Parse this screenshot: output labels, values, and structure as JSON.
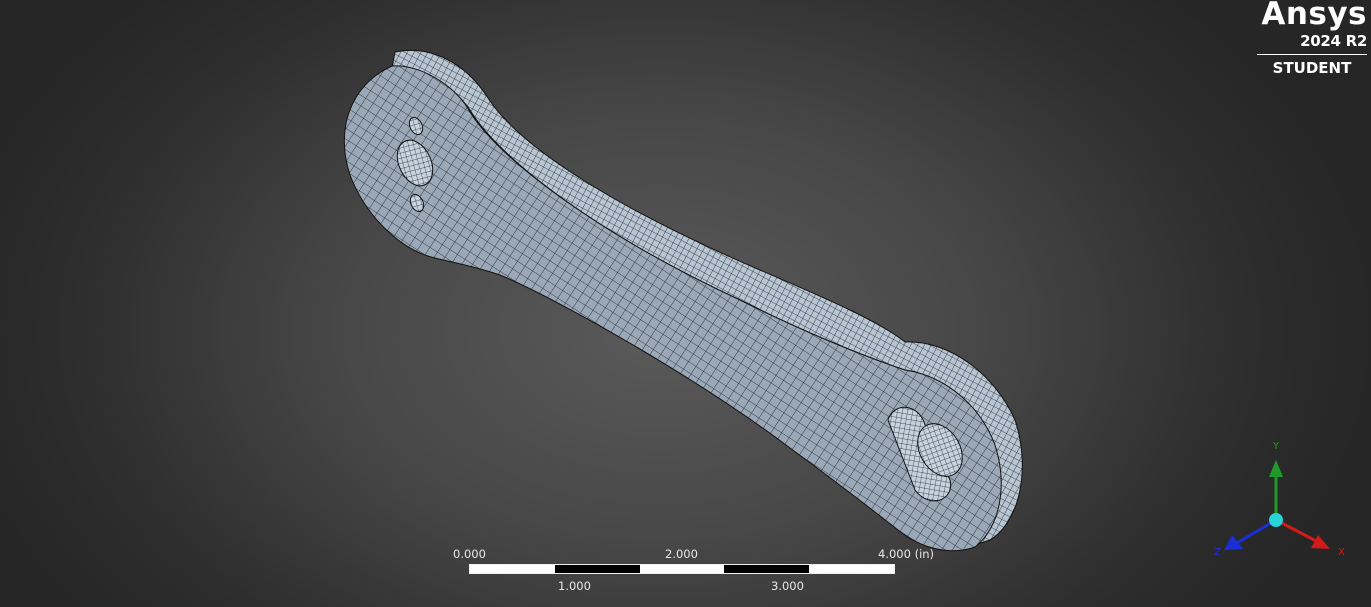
{
  "app": {
    "brand_name": "Ansys",
    "version": "2024 R2",
    "edition": "STUDENT"
  },
  "scale_bar": {
    "labels_top": [
      "0.000",
      "2.000",
      "4.000 (in)"
    ],
    "labels_bottom": [
      "1.000",
      "3.000"
    ]
  },
  "triad": {
    "x_label": "X",
    "y_label": "Y",
    "z_label": "Z",
    "colors": {
      "x": "#d11a1a",
      "y": "#1f9a2a",
      "z": "#1a2fd6",
      "origin": "#28d4d8"
    }
  },
  "model": {
    "description_icon": "meshed-connecting-rod",
    "mesh_color": "#a9b7c6",
    "mesh_line_color": "#1a1f26"
  }
}
